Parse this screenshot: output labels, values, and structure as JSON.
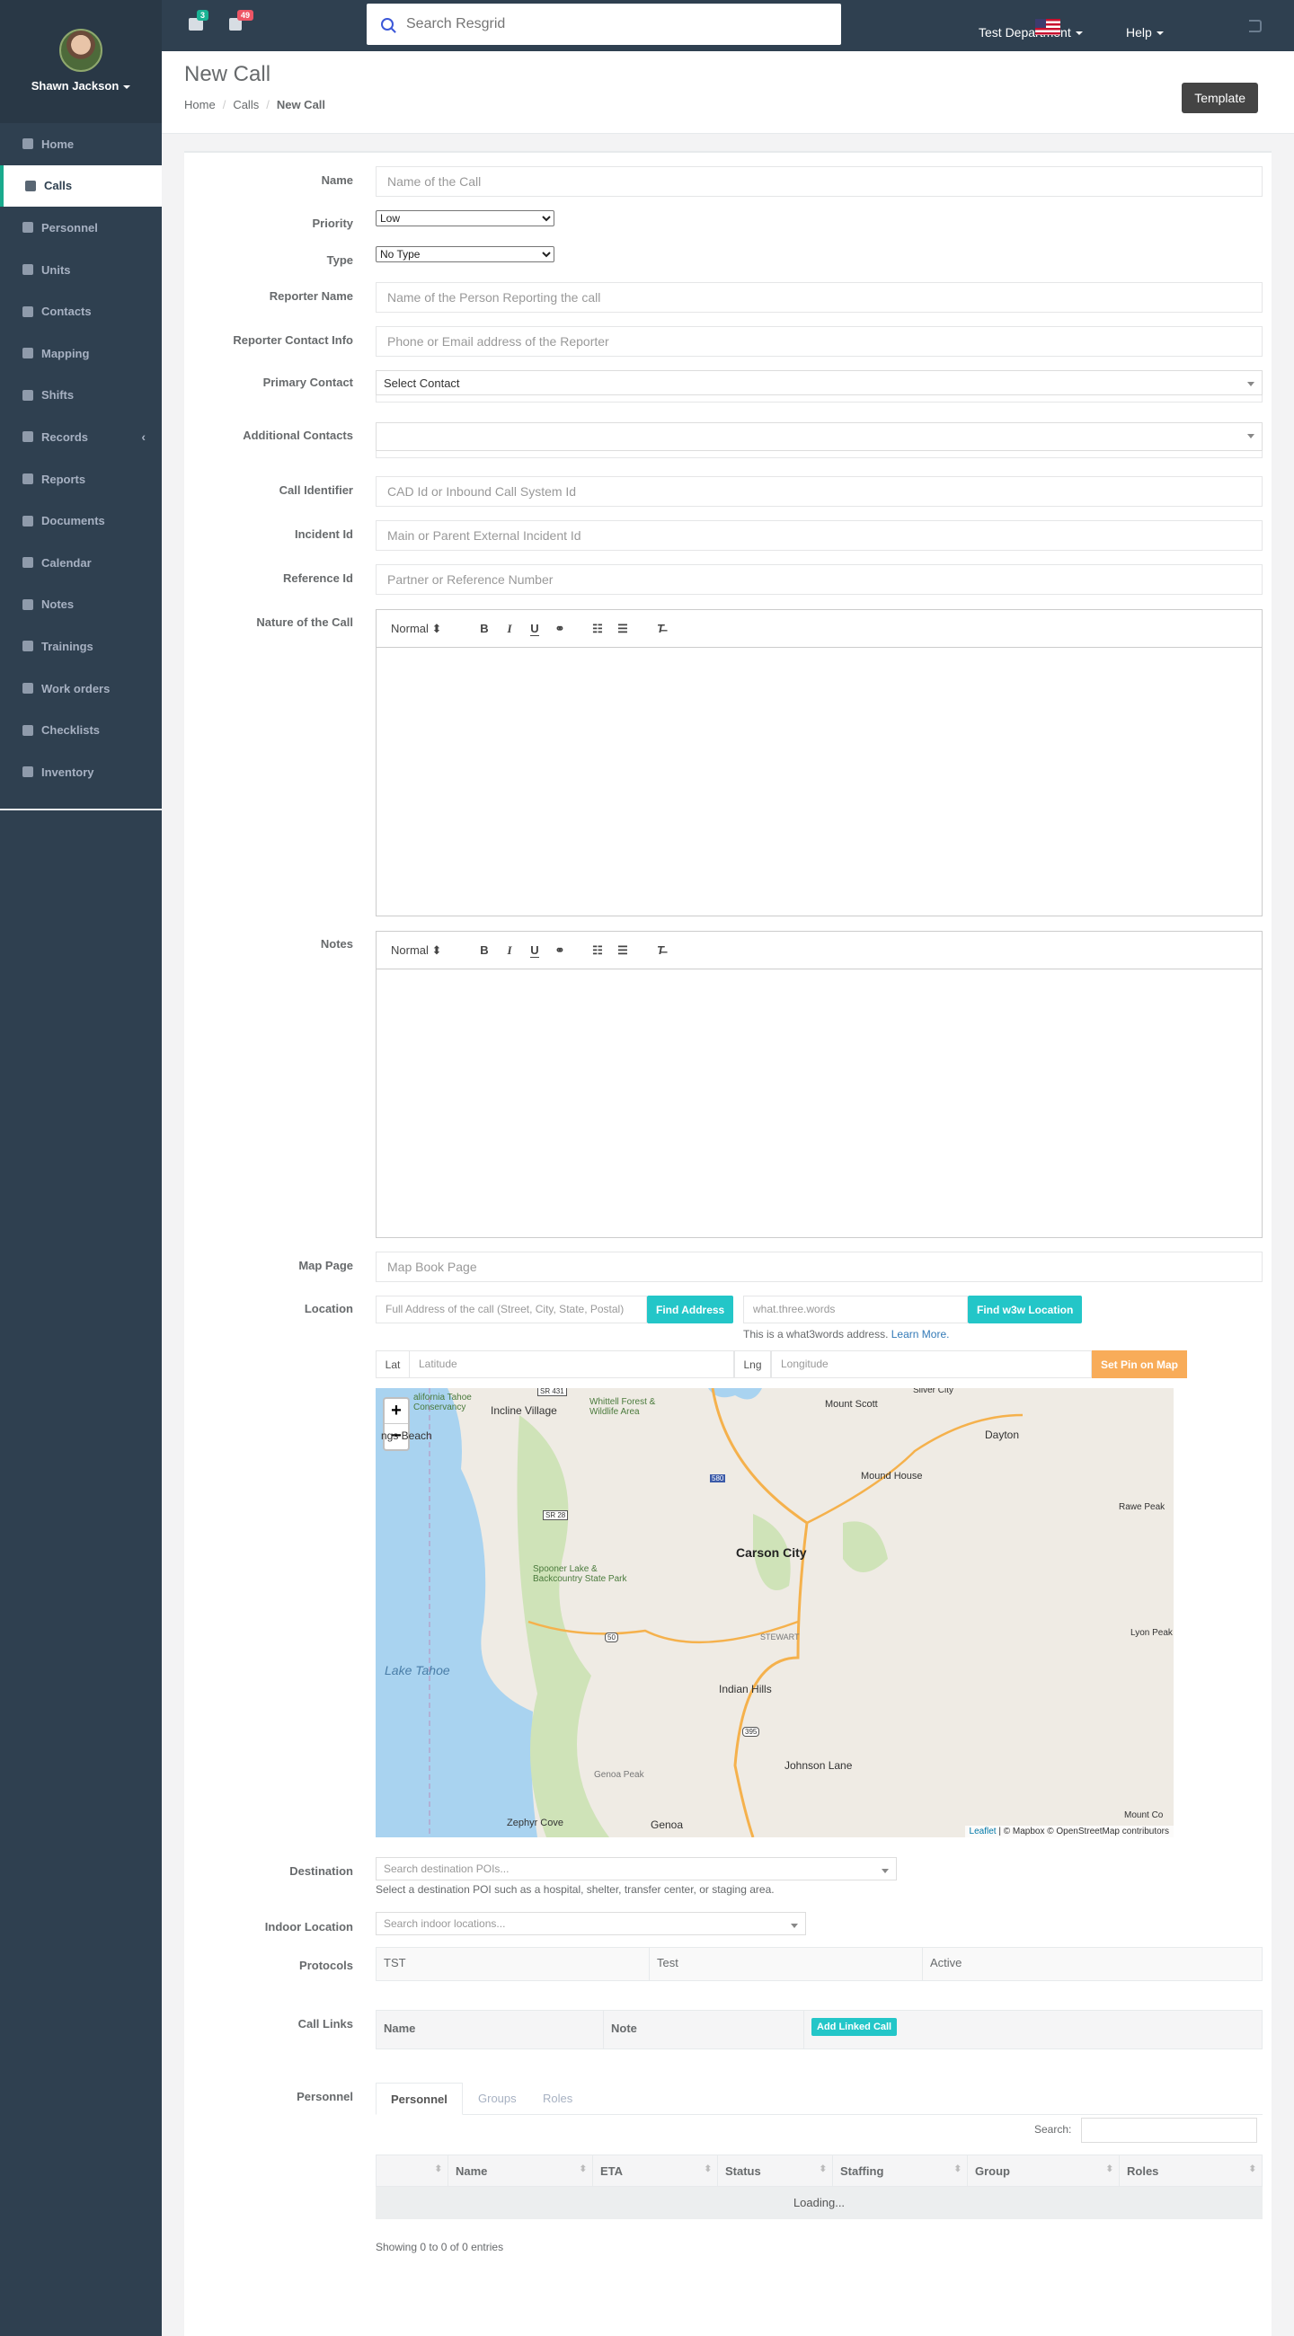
{
  "user": {
    "name": "Shawn Jackson"
  },
  "nav": {
    "items": [
      {
        "label": "Home",
        "icon": "home-icon"
      },
      {
        "label": "Calls",
        "icon": "bullhorn-icon",
        "active": true
      },
      {
        "label": "Personnel",
        "icon": "user-icon"
      },
      {
        "label": "Units",
        "icon": "truck-icon"
      },
      {
        "label": "Contacts",
        "icon": "address-book-icon"
      },
      {
        "label": "Mapping",
        "icon": "map-marker-icon"
      },
      {
        "label": "Shifts",
        "icon": "shifts-icon"
      },
      {
        "label": "Records",
        "icon": "book-icon",
        "expandable": true
      },
      {
        "label": "Reports",
        "icon": "reports-icon"
      },
      {
        "label": "Documents",
        "icon": "documents-icon"
      },
      {
        "label": "Calendar",
        "icon": "calendar-icon"
      },
      {
        "label": "Notes",
        "icon": "notes-icon"
      },
      {
        "label": "Trainings",
        "icon": "trainings-icon"
      },
      {
        "label": "Work orders",
        "icon": "wrench-icon"
      },
      {
        "label": "Checklists",
        "icon": "checklist-icon"
      },
      {
        "label": "Inventory",
        "icon": "inventory-icon"
      }
    ]
  },
  "topbar": {
    "messages_count": "3",
    "alerts_count": "49",
    "search_placeholder": "Search Resgrid",
    "department": "Test Department",
    "help": "Help",
    "colors": {
      "messages_badge": "#1ab394",
      "alerts_badge": "#ed5565"
    }
  },
  "page": {
    "title": "New Call",
    "breadcrumb": [
      "Home",
      "Calls",
      "New Call"
    ],
    "template_button": "Template"
  },
  "form": {
    "name_label": "Name",
    "name_placeholder": "Name of the Call",
    "priority_label": "Priority",
    "priority_value": "Low",
    "type_label": "Type",
    "type_value": "No Type",
    "reporter_name_label": "Reporter Name",
    "reporter_name_placeholder": "Name of the Person Reporting the call",
    "reporter_contact_label": "Reporter Contact Info",
    "reporter_contact_placeholder": "Phone or Email address of the Reporter",
    "primary_contact_label": "Primary Contact",
    "primary_contact_value": "Select Contact",
    "additional_contacts_label": "Additional Contacts",
    "call_identifier_label": "Call Identifier",
    "call_identifier_placeholder": "CAD Id or Inbound Call System Id",
    "incident_id_label": "Incident Id",
    "incident_id_placeholder": "Main or Parent External Incident Id",
    "reference_id_label": "Reference Id",
    "reference_id_placeholder": "Partner or Reference Number",
    "nature_label": "Nature of the Call",
    "notes_label": "Notes",
    "editor_format": "Normal",
    "map_page_label": "Map Page",
    "map_page_placeholder": "Map Book Page",
    "location_label": "Location",
    "address_placeholder": "Full Address of the call (Street, City, State, Postal)",
    "find_address_button": "Find Address",
    "w3w_placeholder": "what.three.words",
    "find_w3w_button": "Find w3w Location",
    "w3w_hint": "This is a what3words address.",
    "w3w_learn_more": "Learn More.",
    "lat_label": "Lat",
    "lat_placeholder": "Latitude",
    "lng_label": "Lng",
    "lng_placeholder": "Longitude",
    "set_pin_button": "Set Pin on Map",
    "destination_label": "Destination",
    "destination_placeholder": "Search destination POIs...",
    "destination_hint": "Select a destination POI such as a hospital, shelter, transfer center, or staging area.",
    "indoor_label": "Indoor Location",
    "indoor_placeholder": "Search indoor locations...",
    "protocols_label": "Protocols",
    "protocols_columns": [
      "TST",
      "Test",
      "Active"
    ],
    "call_links_label": "Call Links",
    "call_links_columns": [
      "Name",
      "Note"
    ],
    "add_linked_call_button": "Add Linked Call",
    "personnel_label": "Personnel",
    "tabs": [
      "Personnel",
      "Groups",
      "Roles"
    ],
    "search_label": "Search:",
    "table_columns": [
      "",
      "Name",
      "ETA",
      "Status",
      "Staffing",
      "Group",
      "Roles"
    ],
    "loading_text": "Loading...",
    "showing_text": "Showing 0 to 0 of 0 entries"
  },
  "map": {
    "zoom_in": "+",
    "zoom_out": "−",
    "labels": [
      "Incline Village",
      "Whittell Forest & Wildlife Area",
      "Mount Scott",
      "Silver City",
      "Dayton",
      "Mound House",
      "Rawe Peak",
      "Carson City",
      "Spooner Lake & Backcountry State Park",
      "Lake Tahoe",
      "STEWART",
      "Lyon Peak",
      "Indian Hills",
      "Johnson Lane",
      "Genoa Peak",
      "Zephyr Cove",
      "Genoa",
      "Mount Co",
      "ngs Beach",
      "alifornia Tahoe Conservancy",
      "SR 431",
      "SR 28",
      "580",
      "50",
      "395"
    ],
    "attribution_link": "Leaflet",
    "attribution_text": " | © Mapbox © OpenStreetMap contributors",
    "colors": {
      "water": "#a9d3f0",
      "land": "#efebe4",
      "forest": "#cfe3b8",
      "road": "#f5b14c"
    }
  }
}
